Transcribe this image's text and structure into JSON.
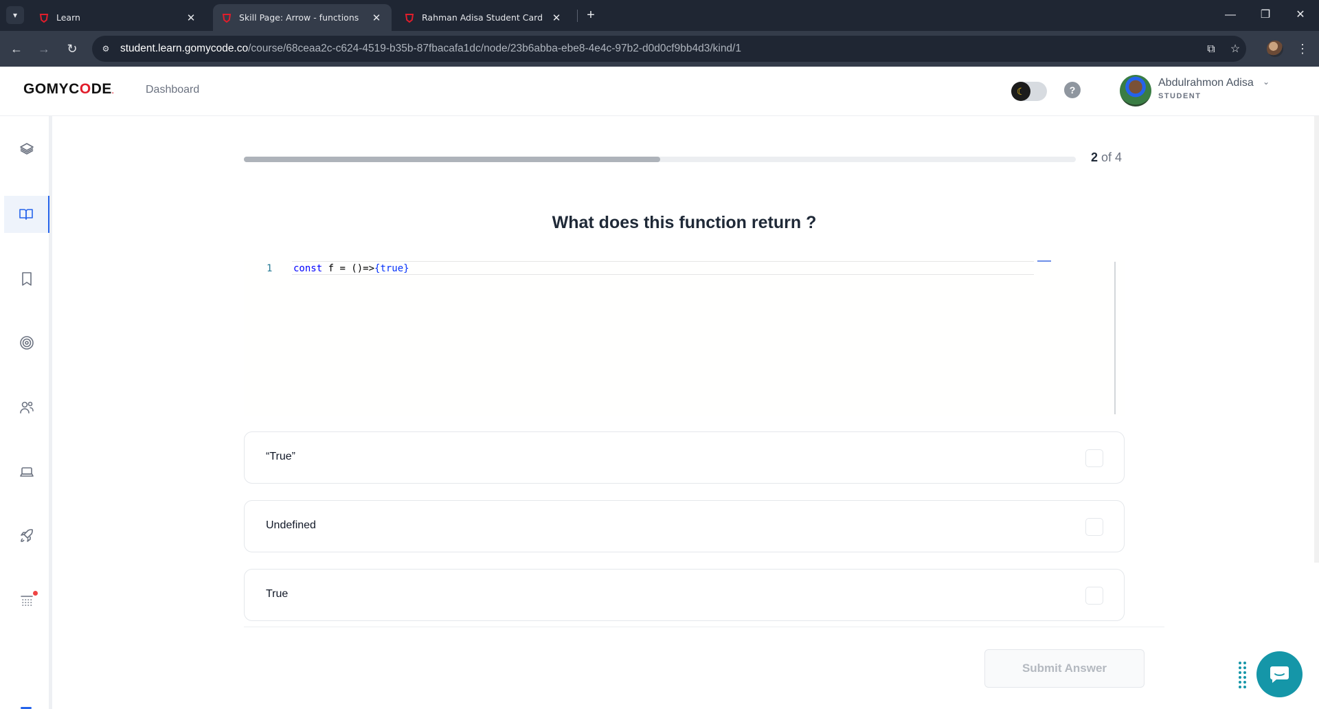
{
  "browser": {
    "tabs": [
      {
        "label": "Learn",
        "active": false
      },
      {
        "label": "Skill Page: Arrow - functions",
        "active": true
      },
      {
        "label": "Rahman Adisa Student Card - Fron",
        "active": false
      }
    ],
    "url_domain": "student.learn.gomycode.co",
    "url_path": "/course/68ceaa2c-c624-4519-b35b-87fbacafa1dc/node/23b6abba-ebe8-4e4c-97b2-d0d0cf9bb4d3/kind/1"
  },
  "header": {
    "logo_prefix": "GOMYC",
    "logo_o": "O",
    "logo_suffix": "DE",
    "logo_dot": ".",
    "dashboard_label": "Dashboard",
    "user_name": "Abdulrahmon Adisa",
    "user_role": "STUDENT"
  },
  "sidebar": {
    "items": [
      {
        "icon": "layers-icon",
        "active": false
      },
      {
        "icon": "book-open-icon",
        "active": true
      },
      {
        "icon": "bookmark-icon",
        "active": false
      },
      {
        "icon": "target-icon",
        "active": false
      },
      {
        "icon": "users-icon",
        "active": false
      },
      {
        "icon": "laptop-icon",
        "active": false
      },
      {
        "icon": "rocket-icon",
        "active": false
      },
      {
        "icon": "calendar-grid-icon",
        "active": false
      }
    ]
  },
  "quiz": {
    "progress_current": "2",
    "progress_of": "of 4",
    "progress_fraction": 0.5,
    "question": "What does this function return ?",
    "code": {
      "line_number": "1",
      "keyword": "const",
      "text": " f = ()=>",
      "brace": "{true}"
    },
    "options": [
      {
        "label": "“True”",
        "checked": false
      },
      {
        "label": "Undefined",
        "checked": false
      },
      {
        "label": "True",
        "checked": false
      }
    ],
    "submit_label": "Submit Answer"
  },
  "colors": {
    "brand_red": "#e11d2b",
    "accent_blue": "#2563eb",
    "chat_teal": "#1596a8"
  }
}
